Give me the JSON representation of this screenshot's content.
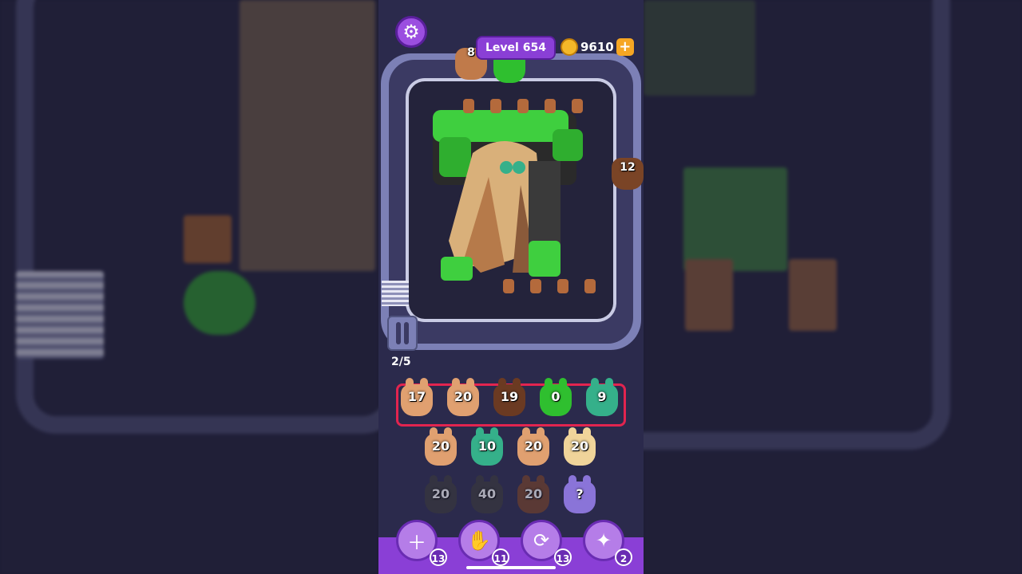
{
  "hud": {
    "level_label": "Level 654",
    "coins": "9610",
    "coin_plus": "+"
  },
  "queue": {
    "count": "2/5"
  },
  "track_critters": [
    {
      "value": "8"
    },
    {
      "value": "12"
    }
  ],
  "slots": [
    {
      "value": "17",
      "color": "#e0a070"
    },
    {
      "value": "20",
      "color": "#e0a070"
    },
    {
      "value": "19",
      "color": "#6b3a22"
    },
    {
      "value": "0",
      "color": "#2fbf2f"
    },
    {
      "value": "9",
      "color": "#35b08a"
    }
  ],
  "grid_rows": [
    [
      {
        "value": "20",
        "color": "#e0a070"
      },
      {
        "value": "10",
        "color": "#35b08a"
      },
      {
        "value": "20",
        "color": "#e0a070"
      },
      {
        "value": "20",
        "color": "#f0d49a"
      }
    ],
    [
      {
        "value": "20",
        "color": "#3a3a3a"
      },
      {
        "value": "40",
        "color": "#3a3a3a"
      },
      {
        "value": "20",
        "color": "#7a4426"
      },
      {
        "value": "?",
        "color": "#8a74d8"
      }
    ]
  ],
  "boosters": [
    {
      "icon": "add-slot-icon",
      "count": "13"
    },
    {
      "icon": "hand-icon",
      "count": "11"
    },
    {
      "icon": "shuffle-icon",
      "count": "13"
    },
    {
      "icon": "vacuum-icon",
      "count": "2"
    }
  ],
  "colors": {
    "accent": "#8a3fd6",
    "slot_border": "#e2244f",
    "leaf_green": "#3fcf3f",
    "wood_light": "#e8c48c",
    "wood_dark": "#8a5a3a"
  }
}
